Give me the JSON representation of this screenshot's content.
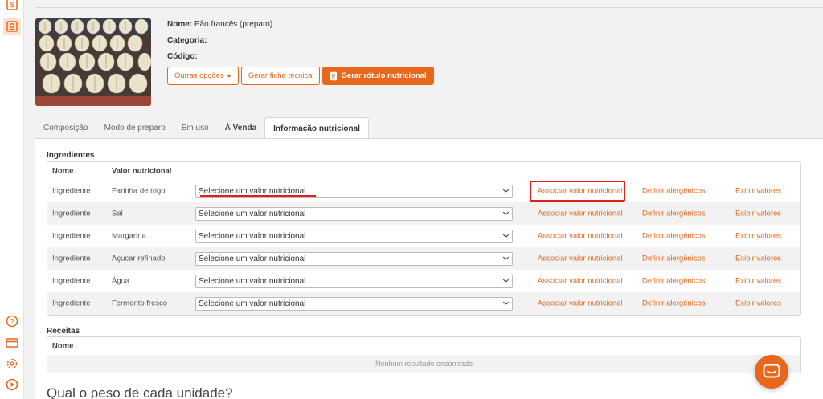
{
  "product": {
    "name_label": "Nome:",
    "name_value": "Pão francês (preparo)",
    "category_label": "Categoria:",
    "category_value": "",
    "code_label": "Código:",
    "code_value": ""
  },
  "buttons": {
    "other_options": "Outras opções",
    "tech_sheet": "Gerar ficha técnica",
    "nutrition_label": "Gerar rótulo nutricional"
  },
  "tabs": [
    "Composição",
    "Modo de preparo",
    "Em uso",
    "À Venda",
    "Informação nutricional"
  ],
  "ingredients": {
    "title": "Ingredientes",
    "columns": {
      "name": "Nome",
      "nutrition": "Valor nutricional"
    },
    "select_placeholder": "Selecione um valor nutricional",
    "actions": {
      "associate": "Associar valor nutricional",
      "allergens": "Definir alergênicos",
      "show": "Exibir valores"
    },
    "rows": [
      {
        "type": "Ingrediente",
        "name": "Farinha de trigo"
      },
      {
        "type": "Ingrediente",
        "name": "Sal"
      },
      {
        "type": "Ingrediente",
        "name": "Margarina"
      },
      {
        "type": "Ingrediente",
        "name": "Açucar refinado"
      },
      {
        "type": "Ingrediente",
        "name": "Água"
      },
      {
        "type": "Ingrediente",
        "name": "Fermento fresco"
      }
    ]
  },
  "recipes": {
    "title": "Receitas",
    "column": "Nome",
    "empty": "Nenhum resultado encontrado"
  },
  "question": "Qual o peso de cada unidade?",
  "colors": {
    "accent": "#e8671d",
    "highlight": "#e41d1d"
  }
}
